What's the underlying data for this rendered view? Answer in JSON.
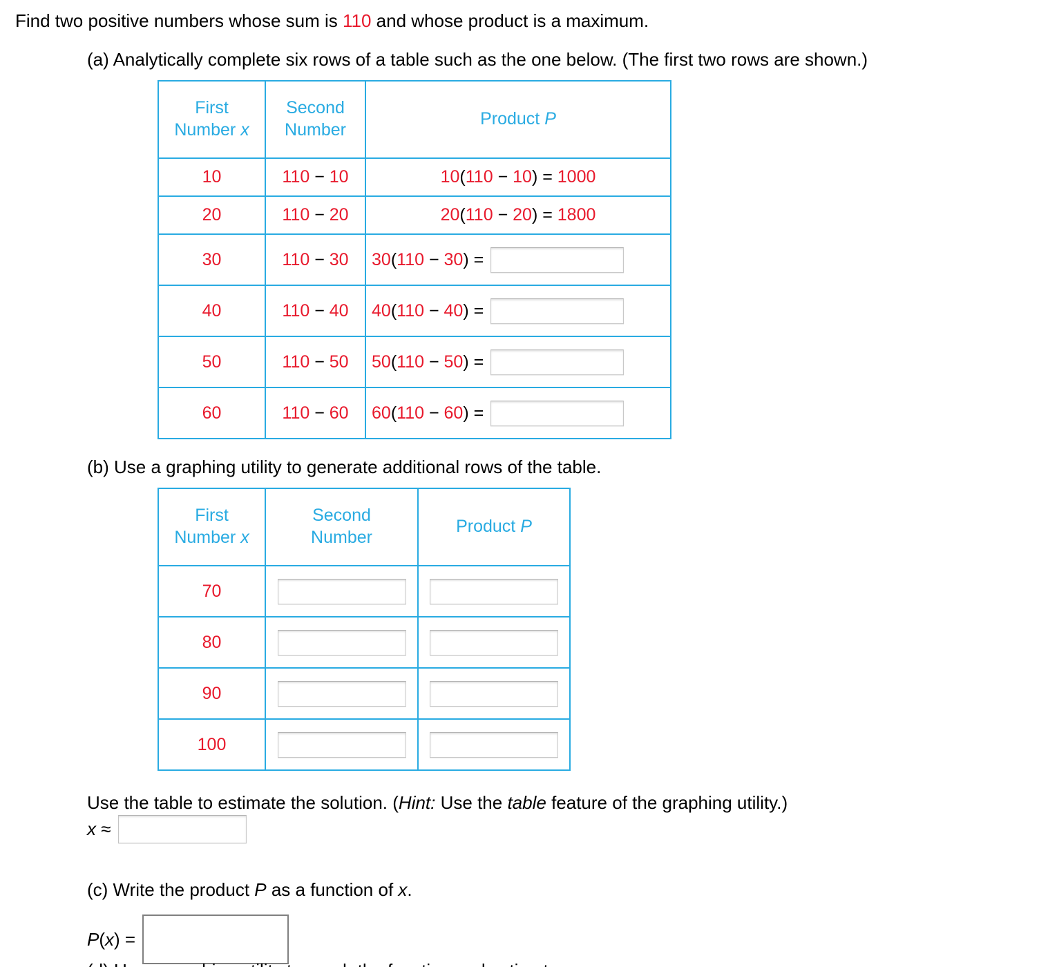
{
  "prompt": {
    "before": "Find two positive numbers whose sum is ",
    "sum_value": "110",
    "after": " and whose product is a maximum."
  },
  "parts": {
    "a_label": "(a) Analytically complete six rows of a table such as the one below. (The first two rows are shown.)",
    "b_label": "(b) Use a graphing utility to generate additional rows of the table.",
    "c_label_pre": "(c) Write the product ",
    "c_label_P": "P",
    "c_label_mid": " as a function of ",
    "c_label_x": "x",
    "c_label_end": "."
  },
  "estimate": {
    "text_pre": "Use the table to estimate the solution. (",
    "hint_word": "Hint:",
    "text_mid": " Use the ",
    "table_word": "table",
    "text_end": " feature of the graphing utility.)",
    "x_label_var": "x",
    "x_label_op": " ≈",
    "x_input_value": ""
  },
  "px": {
    "label_P": "P",
    "label_paren_open": "(",
    "label_x": "x",
    "label_paren_close": ")",
    "label_equals": " =",
    "input_value": ""
  },
  "table_a": {
    "headers": {
      "col1_line1": "First",
      "col1_line2": "Number ",
      "col1_var": "x",
      "col2_line1": "Second",
      "col2_line2": "Number",
      "col3_text": "Product ",
      "col3_var": "P"
    },
    "rows": [
      {
        "first": "10",
        "second_lead": "110 ",
        "second_op": "−",
        "second_tail": " 10",
        "product_lead": "10",
        "product_open": "(",
        "product_inner_a": "110 ",
        "product_inner_op": "−",
        "product_inner_b": " 10",
        "product_close": ")",
        "product_eq": " = ",
        "product_value": "1000",
        "has_input": false
      },
      {
        "first": "20",
        "second_lead": "110 ",
        "second_op": "−",
        "second_tail": " 20",
        "product_lead": "20",
        "product_open": "(",
        "product_inner_a": "110 ",
        "product_inner_op": "−",
        "product_inner_b": " 20",
        "product_close": ")",
        "product_eq": " = ",
        "product_value": "1800",
        "has_input": false
      },
      {
        "first": "30",
        "second_lead": "110 ",
        "second_op": "−",
        "second_tail": " 30",
        "product_lead": "30",
        "product_open": "(",
        "product_inner_a": "110 ",
        "product_inner_op": "−",
        "product_inner_b": " 30",
        "product_close": ")",
        "product_eq": " =",
        "product_value": "",
        "has_input": true
      },
      {
        "first": "40",
        "second_lead": "110 ",
        "second_op": "−",
        "second_tail": " 40",
        "product_lead": "40",
        "product_open": "(",
        "product_inner_a": "110 ",
        "product_inner_op": "−",
        "product_inner_b": " 40",
        "product_close": ")",
        "product_eq": " =",
        "product_value": "",
        "has_input": true
      },
      {
        "first": "50",
        "second_lead": "110 ",
        "second_op": "−",
        "second_tail": " 50",
        "product_lead": "50",
        "product_open": "(",
        "product_inner_a": "110 ",
        "product_inner_op": "−",
        "product_inner_b": " 50",
        "product_close": ")",
        "product_eq": " =",
        "product_value": "",
        "has_input": true
      },
      {
        "first": "60",
        "second_lead": "110 ",
        "second_op": "−",
        "second_tail": " 60",
        "product_lead": "60",
        "product_open": "(",
        "product_inner_a": "110 ",
        "product_inner_op": "−",
        "product_inner_b": " 60",
        "product_close": ")",
        "product_eq": " =",
        "product_value": "",
        "has_input": true
      }
    ]
  },
  "table_b": {
    "headers": {
      "col1_line1": "First",
      "col1_line2": "Number ",
      "col1_var": "x",
      "col2_line1": "Second",
      "col2_line2": "Number",
      "col3_text": "Product ",
      "col3_var": "P"
    },
    "rows": [
      {
        "first": "70",
        "second_value": "",
        "product_value": ""
      },
      {
        "first": "80",
        "second_value": "",
        "product_value": ""
      },
      {
        "first": "90",
        "second_value": "",
        "product_value": ""
      },
      {
        "first": "100",
        "second_value": "",
        "product_value": ""
      }
    ]
  },
  "bottom_cutoff": "(d) Use a graphing utility to graph the function and estimate",
  "colors": {
    "table_border": "#29abe2",
    "header_text": "#29abe2",
    "value_text": "#e8192c",
    "body_text": "#000000"
  }
}
